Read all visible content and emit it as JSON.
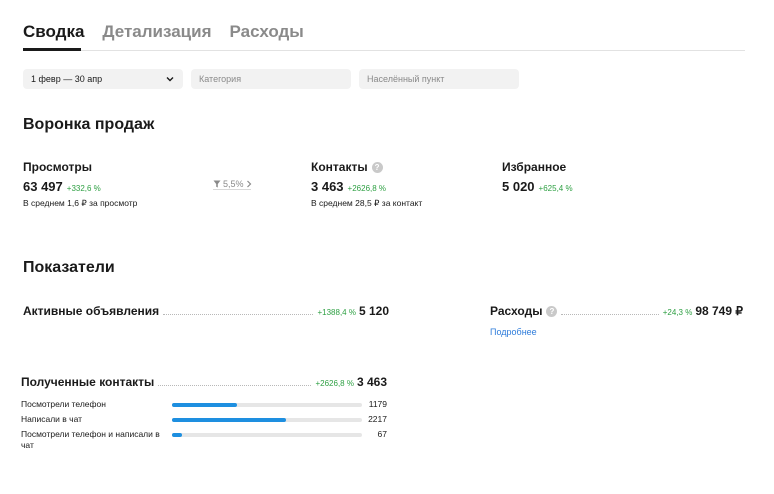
{
  "tabs": [
    {
      "label": "Сводка",
      "active": true
    },
    {
      "label": "Детализация",
      "active": false
    },
    {
      "label": "Расходы",
      "active": false
    }
  ],
  "filters": {
    "date": "1 февр — 30 апр",
    "category_placeholder": "Категория",
    "location_placeholder": "Населённый пункт"
  },
  "funnel": {
    "title": "Воронка продаж",
    "views": {
      "label": "Просмотры",
      "value": "63 497",
      "delta": "+332,6 %",
      "sub": "В среднем 1,6 ₽ за просмотр"
    },
    "conversion": "5,5%",
    "contacts": {
      "label": "Контакты",
      "value": "3 463",
      "delta": "+2626,8 %",
      "sub": "В среднем 28,5 ₽ за контакт"
    },
    "favorites": {
      "label": "Избранное",
      "value": "5 020",
      "delta": "+625,4 %"
    }
  },
  "metrics": {
    "title": "Показатели",
    "active_ads": {
      "label": "Активные объявления",
      "delta": "+1388,4 %",
      "value": "5 120"
    },
    "expenses": {
      "label": "Расходы",
      "delta": "+24,3 %",
      "value": "98 749 ₽",
      "link": "Подробнее"
    },
    "received_contacts": {
      "label": "Полученные контакты",
      "delta": "+2626,8 %",
      "value": "3 463"
    },
    "breakdown": [
      {
        "label": "Посмотрели телефон",
        "value": "1179",
        "fraction": 0.34
      },
      {
        "label": "Написали в чат",
        "value": "2217",
        "fraction": 0.6
      },
      {
        "label": "Посмотрели телефон и написали в чат",
        "value": "67",
        "fraction": 0.05
      }
    ]
  },
  "colors": {
    "accent": "#1e8fe0",
    "positive": "#2ea043",
    "link": "#2f7ddb"
  }
}
